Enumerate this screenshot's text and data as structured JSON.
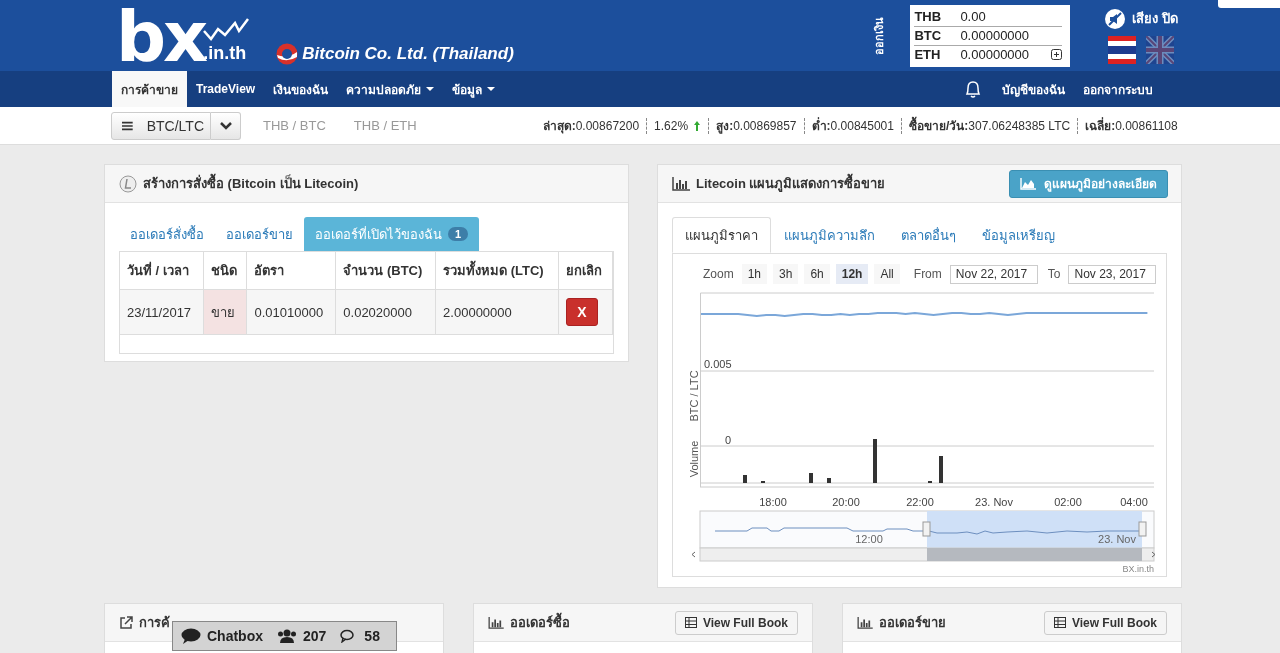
{
  "header": {
    "logo": {
      "main": "bx",
      "domain": ".in.th"
    },
    "company": "Bitcoin Co. Ltd. (Thailand)",
    "withdraw": "ออกเงิน",
    "balances": [
      {
        "currency": "THB",
        "amount": "0.00"
      },
      {
        "currency": "BTC",
        "amount": "0.00000000"
      },
      {
        "currency": "ETH",
        "amount": "0.00000000"
      }
    ],
    "sound": "เสียง ปิด",
    "languages": [
      {
        "kind": "thai",
        "selected": true
      },
      {
        "kind": "uk",
        "selected": false
      }
    ]
  },
  "nav": {
    "items": [
      {
        "label": "การค้าขาย",
        "selected": true,
        "dropdown": false
      },
      {
        "label": "TradeView",
        "selected": false,
        "dropdown": false
      },
      {
        "label": "เงินของฉัน",
        "selected": false,
        "dropdown": false
      },
      {
        "label": "ความปลอดภัย",
        "selected": false,
        "dropdown": true
      },
      {
        "label": "ข้อมูล",
        "selected": false,
        "dropdown": true
      }
    ],
    "right": [
      "บัญชีของฉัน",
      "ออกจากระบบ"
    ]
  },
  "ticker": {
    "pair": "BTC/LTC",
    "other_pairs": [
      "THB / BTC",
      "THB / ETH"
    ],
    "stats": [
      {
        "label": "ล่าสุด:",
        "value": "0.00867200"
      },
      {
        "value": "1.62%",
        "rising": true
      },
      {
        "label": "สูง:",
        "value": "0.00869857"
      },
      {
        "label": "ต่ำ:",
        "value": "0.00845001"
      },
      {
        "label": "ซื้อขาย/วัน:",
        "value": "307.06248385 LTC"
      },
      {
        "label": "เฉลี่ย:",
        "value": "0.00861108"
      }
    ]
  },
  "order_panel": {
    "title": "สร้างการสั่งซื้อ (Bitcoin เป็น Litecoin)",
    "tabs": [
      {
        "label": "ออเดอร์สั่งซื้อ",
        "selected": false
      },
      {
        "label": "ออเดอร์ขาย",
        "selected": false
      },
      {
        "label": "ออเดอร์ที่เปิดไว้ของฉัน",
        "selected": true,
        "badge": "1"
      }
    ],
    "columns": [
      "วันที่ / เวลา",
      "ชนิด",
      "อัตรา",
      "จำนวน (BTC)",
      "รวมทั้งหมด (LTC)",
      "ยกเลิก"
    ],
    "rows": [
      {
        "date": "23/11/2017",
        "type": "ขาย",
        "kind": "sell",
        "rate": "0.01010000",
        "amount": "0.02020000",
        "total": "2.00000000",
        "cancel": "X"
      }
    ]
  },
  "chart_panel": {
    "title": "Litecoin แผนภูมิแสดงการซื้อขาย",
    "detail_button": "ดูแผนภูมิอย่างละเอียด",
    "tabs": [
      {
        "label": "แผนภูมิราคา",
        "selected": true
      },
      {
        "label": "แผนภูมิความลึก",
        "selected": false
      },
      {
        "label": "ตลาดอื่นๆ",
        "selected": false
      },
      {
        "label": "ข้อมูลเหรียญ",
        "selected": false
      }
    ],
    "zoom_label": "Zoom",
    "zoom": [
      {
        "label": "1h",
        "selected": false
      },
      {
        "label": "3h",
        "selected": false
      },
      {
        "label": "6h",
        "selected": false
      },
      {
        "label": "12h",
        "selected": true
      },
      {
        "label": "All",
        "selected": false
      }
    ],
    "from_label": "From",
    "from": "Nov 22, 2017",
    "to_label": "To",
    "to": "Nov 23, 2017",
    "price_axis": "BTC / LTC",
    "volume_axis": "Volume",
    "price_tick": "0.005",
    "volume_tick": "0",
    "x_ticks": [
      "18:00",
      "20:00",
      "22:00",
      "23. Nov",
      "02:00",
      "04:00"
    ],
    "navigator_ticks": [
      "12:00",
      "23. Nov"
    ],
    "credit": "BX.in.th"
  },
  "bottom_panels": [
    {
      "kind": "trades",
      "title": "การค้"
    },
    {
      "kind": "book",
      "title": "ออเดอร์ซื้อ",
      "button": "View Full Book"
    },
    {
      "kind": "book",
      "title": "ออเดอร์ขาย",
      "button": "View Full Book"
    }
  ],
  "chatbox": {
    "label": "Chatbox",
    "users": "207",
    "messages": "58"
  }
}
